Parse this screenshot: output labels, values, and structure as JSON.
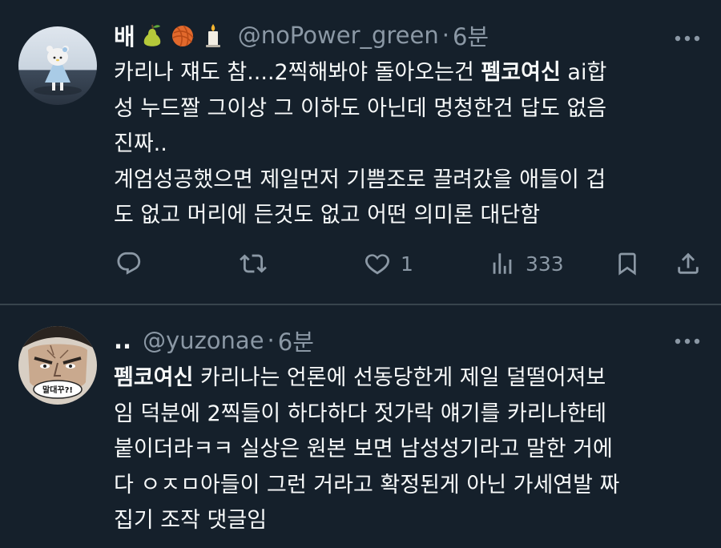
{
  "tweets": [
    {
      "display_name": "배",
      "emoji_icons": [
        "pear-emoji",
        "yarn-emoji",
        "candle-emoji"
      ],
      "handle": "@noPower_green",
      "separator": "·",
      "time": "6분",
      "lines": [
        [
          "카리나 쟤도 참....2찍해봐야 돌아오는건 ",
          "펨코여신",
          " ai합"
        ],
        [
          "성 누드짤 그이상 그 이하도 아닌데 멍청한건 답도 없음"
        ],
        [
          "진짜.."
        ],
        [
          "계엄성공했으면 제일먼저 기쁨조로 끌려갔을 애들이 겁"
        ],
        [
          "도 없고 머리에 든것도 없고 어떤 의미론 대단함"
        ]
      ],
      "like_count": "1",
      "view_count": "333"
    },
    {
      "display_name": "..",
      "handle": "@yuzonae",
      "separator": "·",
      "time": "6분",
      "avatar_caption": "말대꾸?!",
      "lines": [
        [
          "펨코여신",
          " 카리나는 언론에 선동당한게 제일 덜떨어져보"
        ],
        [
          "임 덕분에 2찍들이 하다하다 젓가락 얘기를 카리나한테"
        ],
        [
          "붙이더라ㅋㅋ 실상은 원본 보면 남성성기라고 말한 거에"
        ],
        [
          "다 ㅇㅈㅁ아들이 그런 거라고 확정된게 아닌 가세연발 짜"
        ],
        [
          "집기 조작 댓글임"
        ]
      ]
    }
  ]
}
